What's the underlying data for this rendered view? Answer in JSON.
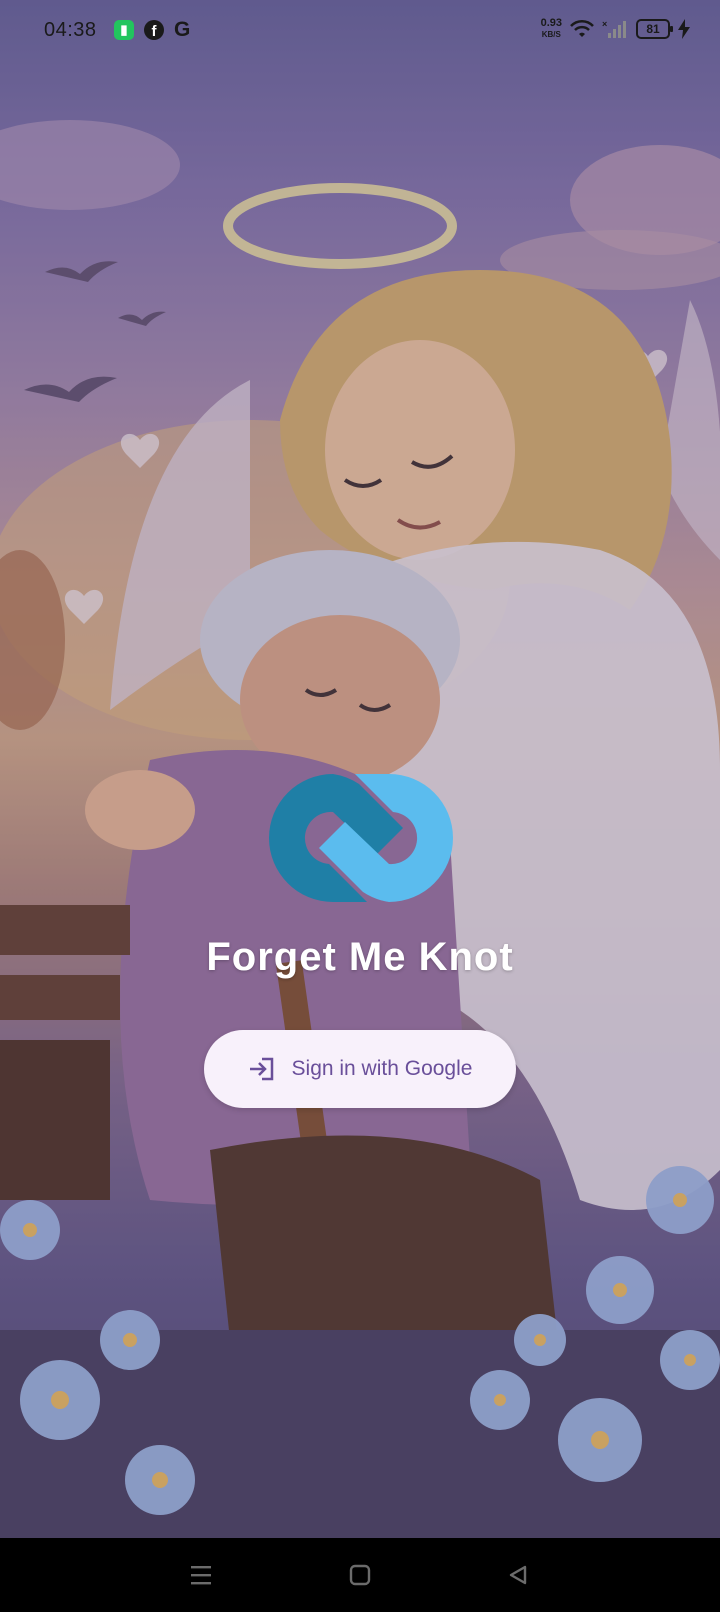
{
  "status_bar": {
    "time": "04:38",
    "net_speed_value": "0.93",
    "net_speed_unit": "KB/S",
    "battery_level": "81"
  },
  "app": {
    "title": "Forget Me Knot",
    "signin_label": "Sign in with Google"
  },
  "icons": {
    "signin": "login-arrow-icon",
    "logo": "infinity-knot-logo-icon"
  },
  "colors": {
    "logo_dark": "#1f7fa6",
    "logo_light": "#5bbcee",
    "button_bg": "#f8f1fb",
    "button_text": "#6a4f9a"
  }
}
